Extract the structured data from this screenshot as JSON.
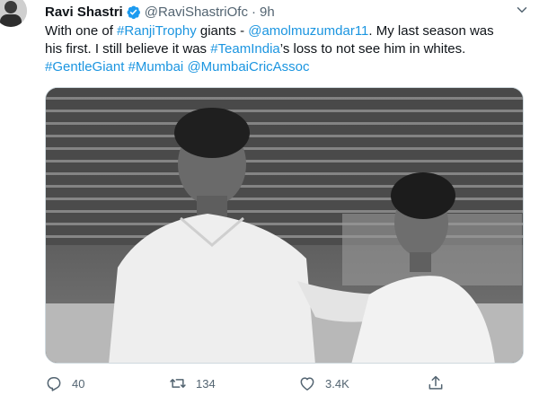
{
  "tweet": {
    "author_name": "Ravi Shastri",
    "handle": "@RaviShastriOfc",
    "separator": "·",
    "time": "9h",
    "text": {
      "l1_a": "With one of ",
      "l1_tag": "#RanjiTrophy",
      "l1_b": " giants - ",
      "l1_mention": "@amolmuzumdar11",
      "l1_c": ". My last season was",
      "l2_a": "his first. I still believe it was ",
      "l2_tag": "#TeamIndia",
      "l2_b": "’s loss to not see him in whites.",
      "l3_tag1": "#GentleGiant",
      "l3_sp1": " ",
      "l3_tag2": "#Mumbai",
      "l3_sp2": " ",
      "l3_mention": "@MumbaiCricAssoc"
    },
    "actions": {
      "replies": "40",
      "retweets": "134",
      "likes": "3.4K"
    }
  },
  "icons": {
    "verified": "verified-badge-icon",
    "caret": "chevron-down-icon",
    "reply": "reply-icon",
    "retweet": "retweet-icon",
    "like": "heart-icon",
    "share": "share-icon"
  },
  "colors": {
    "link": "#1b95e0",
    "verified": "#1d9bf0",
    "muted": "#536471",
    "text": "#0f1419"
  }
}
